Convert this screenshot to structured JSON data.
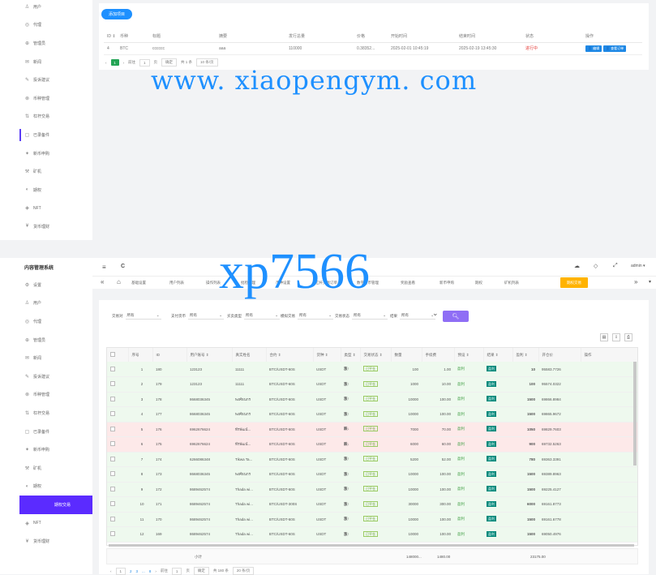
{
  "sidebar_top": [
    {
      "label": "用户",
      "icon": "user-icon"
    },
    {
      "label": "代理",
      "icon": "agent-icon"
    },
    {
      "label": "管理员",
      "icon": "admin-icon"
    },
    {
      "label": "新闻",
      "icon": "news-icon"
    },
    {
      "label": "投诉建议",
      "icon": "feedback-icon"
    },
    {
      "label": "币种管理",
      "icon": "coin-icon"
    },
    {
      "label": "杠杆交易",
      "icon": "leverage-icon"
    },
    {
      "label": "已录备件",
      "icon": "record-icon"
    },
    {
      "label": "新币申购",
      "icon": "newcoin-icon"
    },
    {
      "label": "矿机",
      "icon": "miner-icon"
    },
    {
      "label": "期权",
      "icon": "option-icon"
    },
    {
      "label": "NFT",
      "icon": "nft-icon"
    },
    {
      "label": "货币理财",
      "icon": "finance-icon"
    }
  ],
  "system_title": "内容管理系统",
  "sidebar_bottom": [
    {
      "label": "设置",
      "icon": "settings-icon"
    },
    {
      "label": "用户",
      "icon": "user-icon"
    },
    {
      "label": "代理",
      "icon": "agent-icon"
    },
    {
      "label": "管理员",
      "icon": "admin-icon"
    },
    {
      "label": "新闻",
      "icon": "news-icon"
    },
    {
      "label": "投诉建议",
      "icon": "feedback-icon"
    },
    {
      "label": "币种管理",
      "icon": "coin-icon"
    },
    {
      "label": "杠杆交易",
      "icon": "leverage-icon"
    },
    {
      "label": "已录备件",
      "icon": "record-icon"
    },
    {
      "label": "新币申购",
      "icon": "newcoin-icon"
    },
    {
      "label": "矿机",
      "icon": "miner-icon"
    },
    {
      "label": "期权",
      "icon": "option-icon"
    },
    {
      "label": "期权交易",
      "icon": ""
    },
    {
      "label": "NFT",
      "icon": "nft-icon"
    },
    {
      "label": "货币理财",
      "icon": "finance-icon"
    }
  ],
  "top_card": {
    "add_button": "添加项目",
    "headers": [
      "ID ⇕",
      "币种",
      "标题",
      "摘要",
      "发行总量",
      "价格",
      "开始时间",
      "结束时间",
      "状态",
      "操作"
    ],
    "row": [
      "4",
      "BTC",
      "cccccc",
      "aaa",
      "110000",
      "0.38352...",
      "2025-02-01 10:45:19",
      "2025-02-19 13:45:30",
      "进行中"
    ],
    "action_edit": "编辑",
    "action_view": "查看订单",
    "pager": {
      "prev": "‹",
      "page": "1",
      "next": "›",
      "goto_label": "前往",
      "goto_val": "1",
      "page_suffix": "页",
      "confirm": "确定",
      "total": "共 1 条",
      "size": "10 条/页"
    }
  },
  "watermark_url": "www. xiaopengym. com",
  "watermark_code": "xp7566",
  "topbar": {
    "menu_icon": "≡",
    "refresh_icon": "C",
    "user": "admin ▾"
  },
  "tabs": [
    "基础设置",
    "用户列表",
    "操作列表",
    "批检管理",
    "币种设置",
    "杠杆交易订单",
    "数字货币管理",
    "奖励查看",
    "新币申购",
    "期权",
    "矿机列表",
    "期权交易"
  ],
  "filters": [
    {
      "label": "交易对",
      "value": "所有"
    },
    {
      "label": "支付货币",
      "value": "所有"
    },
    {
      "label": "买卖类型",
      "value": "所有"
    },
    {
      "label": "模拟交易",
      "value": "所有"
    },
    {
      "label": "交易状态",
      "value": "所有"
    },
    {
      "label": "结果",
      "value": "所有"
    }
  ],
  "table_headers": [
    "",
    "序号",
    "ID",
    "用户账号 ⇕",
    "真实姓名",
    "合约 ⇕",
    "货种 ⇕",
    "类型 ⇕",
    "交易状态 ⇕",
    "数量",
    "手续费",
    "预设 ⇕",
    "结果 ⇕",
    "盈利 ⇕",
    "开仓价",
    "操作"
  ],
  "rows": [
    {
      "n": "1",
      "id": "180",
      "acct": "123123",
      "name": "11111",
      "pair": "BTC/USDT-60S",
      "cur": "USDT",
      "type": "涨↑",
      "status": "已平仓",
      "qty": "100",
      "fee": "1.00",
      "preset": "盈利",
      "result": "盈利",
      "profit": "10",
      "price": "95583.7726",
      "kind": "buy"
    },
    {
      "n": "2",
      "id": "179",
      "acct": "123123",
      "name": "11111",
      "pair": "BTC/USDT-60S",
      "cur": "USDT",
      "type": "涨↑",
      "status": "已平仓",
      "qty": "1000",
      "fee": "10.00",
      "preset": "盈利",
      "result": "盈利",
      "profit": "100",
      "price": "95574.0322",
      "kind": "buy"
    },
    {
      "n": "3",
      "id": "178",
      "acct": "8668036345",
      "name": "พงศ์ธนกร",
      "pair": "BTC/USDT-60S",
      "cur": "USDT",
      "type": "涨↑",
      "status": "已平仓",
      "qty": "10000",
      "fee": "100.00",
      "preset": "盈利",
      "result": "盈利",
      "profit": "1500",
      "price": "69866.8984",
      "kind": "buy"
    },
    {
      "n": "4",
      "id": "177",
      "acct": "8668036345",
      "name": "พงศ์ธนกร",
      "pair": "BTC/USDT-60S",
      "cur": "USDT",
      "type": "涨↑",
      "status": "已平仓",
      "qty": "10000",
      "fee": "100.00",
      "preset": "盈利",
      "result": "盈利",
      "profit": "1500",
      "price": "69865.9672",
      "kind": "buy"
    },
    {
      "n": "5",
      "id": "176",
      "acct": "6962676624",
      "name": "พีรพัฒน์...",
      "pair": "BTC/USDT-60S",
      "cur": "USDT",
      "type": "跌↓",
      "status": "已平仓",
      "qty": "7000",
      "fee": "70.00",
      "preset": "盈利",
      "result": "盈利",
      "profit": "1050",
      "price": "69829.7603",
      "kind": "sell"
    },
    {
      "n": "6",
      "id": "175",
      "acct": "6962676624",
      "name": "พีรพัฒน์...",
      "pair": "BTC/USDT-60S",
      "cur": "USDT",
      "type": "跌↓",
      "status": "已平仓",
      "qty": "6000",
      "fee": "60.00",
      "preset": "盈利",
      "result": "盈利",
      "profit": "900",
      "price": "69732.5263",
      "kind": "sell"
    },
    {
      "n": "7",
      "id": "174",
      "acct": "6266086348",
      "name": "Tikwa Ta...",
      "pair": "BTC/USDT-60S",
      "cur": "USDT",
      "type": "涨↑",
      "status": "已平仓",
      "qty": "5200",
      "fee": "52.00",
      "preset": "盈利",
      "result": "盈利",
      "profit": "780",
      "price": "69363.3391",
      "kind": "buy"
    },
    {
      "n": "8",
      "id": "173",
      "acct": "8668036345",
      "name": "พงศ์ธนกร",
      "pair": "BTC/USDT-60S",
      "cur": "USDT",
      "type": "涨↑",
      "status": "已平仓",
      "qty": "10000",
      "fee": "100.00",
      "preset": "盈利",
      "result": "盈利",
      "profit": "1500",
      "price": "69389.8963",
      "kind": "buy"
    },
    {
      "n": "9",
      "id": "172",
      "acct": "8689462574",
      "name": "Thada wi...",
      "pair": "BTC/USDT-60S",
      "cur": "USDT",
      "type": "涨↑",
      "status": "已平仓",
      "qty": "10000",
      "fee": "100.00",
      "preset": "盈利",
      "result": "盈利",
      "profit": "1500",
      "price": "69225.4127",
      "kind": "buy"
    },
    {
      "n": "10",
      "id": "171",
      "acct": "8689462574",
      "name": "Thada wi...",
      "pair": "BTC/USDT-300S",
      "cur": "USDT",
      "type": "涨↑",
      "status": "已平仓",
      "qty": "30000",
      "fee": "300.00",
      "preset": "盈利",
      "result": "盈利",
      "profit": "6000",
      "price": "69161.8773",
      "kind": "buy"
    },
    {
      "n": "11",
      "id": "170",
      "acct": "8689462574",
      "name": "Thada wi...",
      "pair": "BTC/USDT-60S",
      "cur": "USDT",
      "type": "涨↑",
      "status": "已平仓",
      "qty": "10000",
      "fee": "100.00",
      "preset": "盈利",
      "result": "盈利",
      "profit": "1500",
      "price": "69161.6778",
      "kind": "buy"
    },
    {
      "n": "12",
      "id": "169",
      "acct": "8689462574",
      "name": "Thada wi...",
      "pair": "BTC/USDT-60S",
      "cur": "USDT",
      "type": "涨↑",
      "status": "已平仓",
      "qty": "10000",
      "fee": "100.00",
      "preset": "盈利",
      "result": "盈利",
      "profit": "1500",
      "price": "69050.4976",
      "kind": "buy"
    }
  ],
  "summary": {
    "label": "小计",
    "qty": "148000...",
    "fee": "1480.00",
    "profit": "23175.00"
  },
  "bottom_pager": {
    "pages": [
      "1",
      "2",
      "3",
      "...",
      "8"
    ],
    "goto_label": "前往",
    "goto_val": "1",
    "page_suffix": "页",
    "confirm": "确定",
    "total": "共 180 条",
    "size": "20 条/页"
  }
}
